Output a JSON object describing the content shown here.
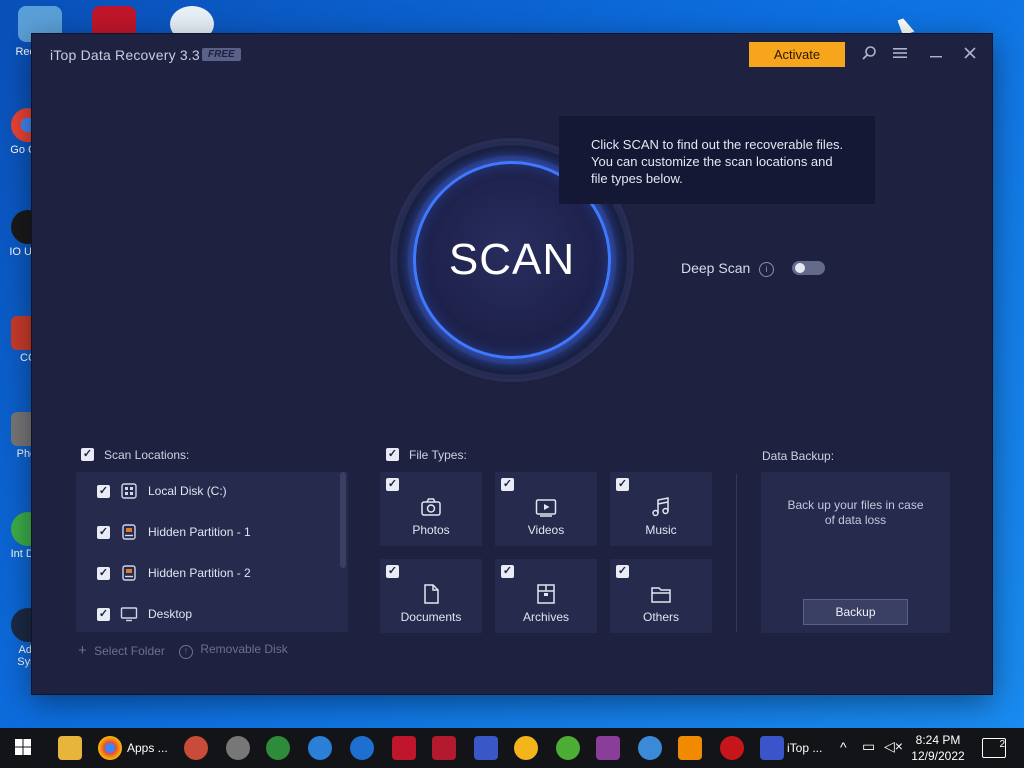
{
  "desktop": {
    "icons": [
      {
        "label": "Recy",
        "icon": "recycle-bin-icon"
      },
      {
        "label": "Go Chr",
        "icon": "chrome-icon"
      },
      {
        "label": "IO Unin",
        "icon": "iobit-uninstaller-icon"
      },
      {
        "label": "CC",
        "icon": "ccleaner-icon"
      },
      {
        "label": "Phot",
        "icon": "photo-app-icon"
      },
      {
        "label": "Int Dov",
        "icon": "internet-download-icon"
      },
      {
        "label": "Adv Syst",
        "icon": "advanced-systemcare-icon"
      }
    ]
  },
  "window": {
    "title": "iTop Data Recovery 3.3",
    "badge": "FREE",
    "activate_label": "Activate"
  },
  "scan": {
    "button_label": "SCAN",
    "tooltip_lines": [
      "Click SCAN to find out the recoverable files.",
      "You can customize the scan locations and",
      "file types below."
    ],
    "deep_scan_label": "Deep Scan",
    "deep_scan_enabled": false
  },
  "locations": {
    "header": "Scan Locations:",
    "items": [
      {
        "label": "Local Disk (C:)",
        "icon": "drive-icon",
        "checked": true
      },
      {
        "label": "Hidden Partition - 1",
        "icon": "partition-icon",
        "checked": true
      },
      {
        "label": "Hidden Partition - 2",
        "icon": "partition-icon",
        "checked": true
      },
      {
        "label": "Desktop",
        "icon": "monitor-icon",
        "checked": true
      }
    ],
    "select_folder": "Select Folder",
    "removable_disk": "Removable Disk"
  },
  "file_types": {
    "header": "File Types:",
    "items": [
      {
        "label": "Photos",
        "icon": "camera-icon",
        "checked": true
      },
      {
        "label": "Videos",
        "icon": "video-icon",
        "checked": true
      },
      {
        "label": "Music",
        "icon": "music-note-icon",
        "checked": true
      },
      {
        "label": "Documents",
        "icon": "document-icon",
        "checked": true
      },
      {
        "label": "Archives",
        "icon": "archive-icon",
        "checked": true
      },
      {
        "label": "Others",
        "icon": "folder-icon",
        "checked": true
      }
    ]
  },
  "backup": {
    "header": "Data Backup:",
    "text_lines": [
      "Back up your files in case",
      "of data loss"
    ],
    "button_label": "Backup"
  },
  "taskbar": {
    "chrome_label": "Apps ...",
    "itop_label": "iTop ...",
    "time": "8:24 PM",
    "date": "12/9/2022",
    "notification_count": "2"
  },
  "colors": {
    "accent_orange": "#f7a51c",
    "scan_glow": "#3f79ff",
    "window_bg": "#1e2140"
  }
}
